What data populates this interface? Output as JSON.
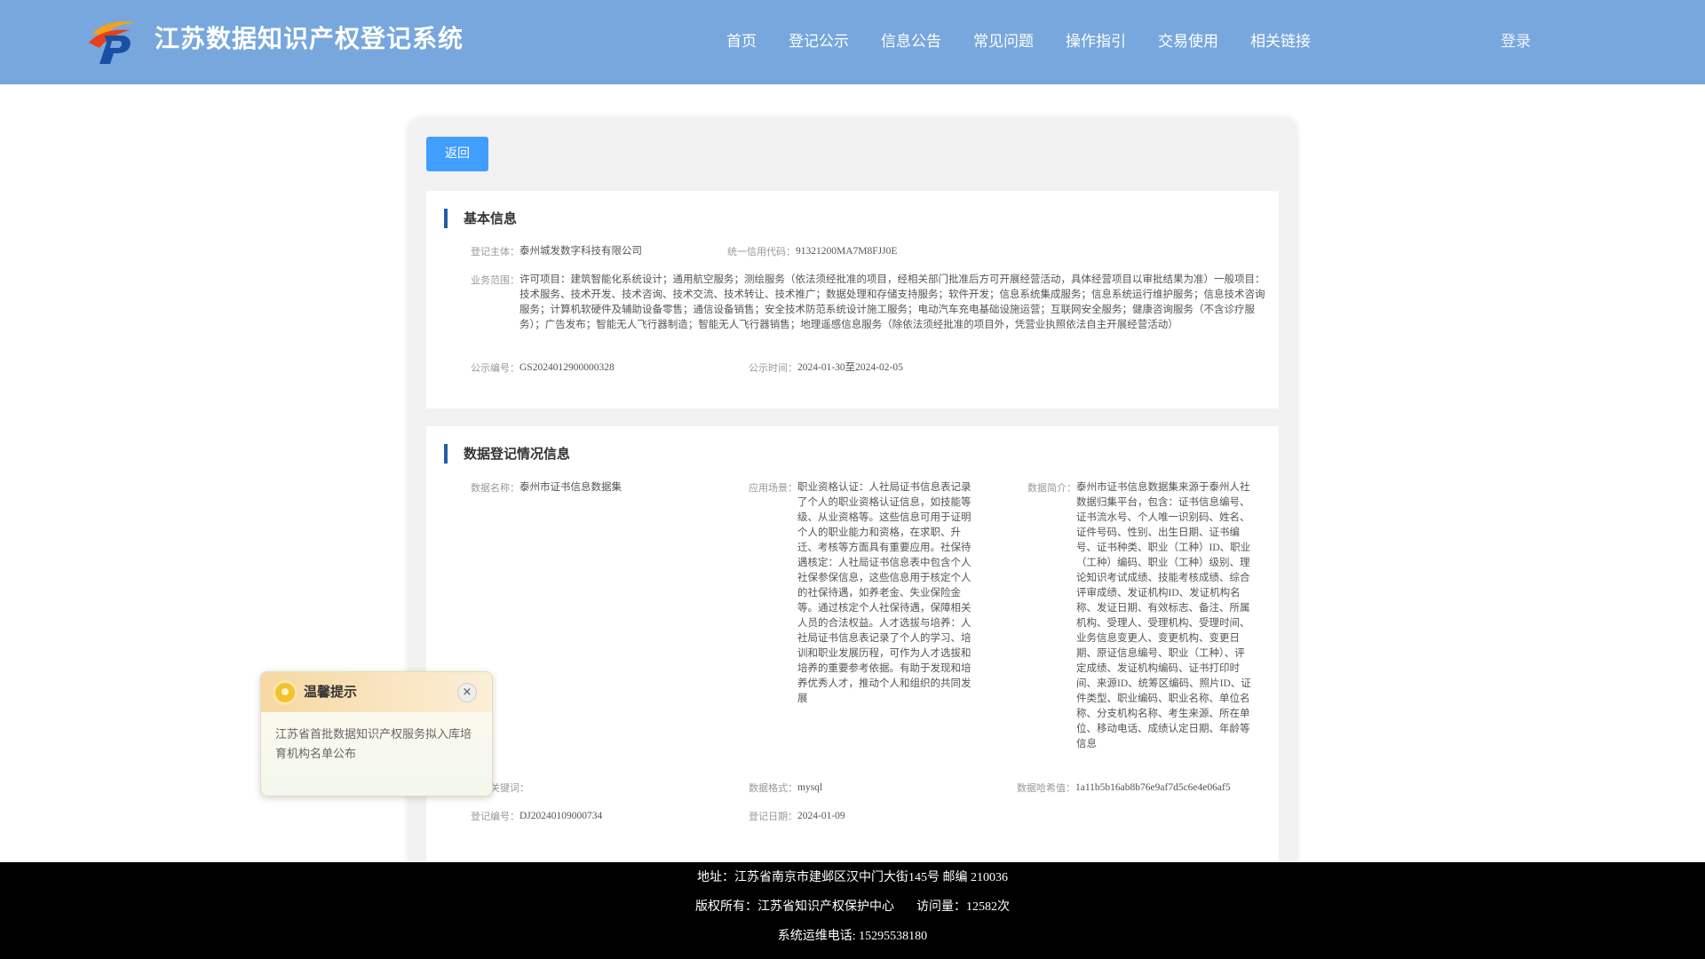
{
  "header": {
    "site_title": "江苏数据知识产权登记系统",
    "nav": [
      "首页",
      "登记公示",
      "信息公告",
      "常见问题",
      "操作指引",
      "交易使用",
      "相关链接"
    ],
    "login": "登录"
  },
  "main": {
    "back_button": "返回",
    "basic_info": {
      "title": "基本信息",
      "subject_label": "登记主体：",
      "subject_value": "泰州城发数字科技有限公司",
      "credit_code_label": "统一信用代码：",
      "credit_code_value": "91321200MA7M8FJJ0E",
      "scope_label": "业务范围：",
      "scope_value": "许可项目：建筑智能化系统设计；通用航空服务；测绘服务（依法须经批准的项目，经相关部门批准后方可开展经营活动，具体经营项目以审批结果为准）一般项目：技术服务、技术开发、技术咨询、技术交流、技术转让、技术推广；数据处理和存储支持服务；软件开发；信息系统集成服务；信息系统运行维护服务；信息技术咨询服务；计算机软硬件及辅助设备零售；通信设备销售；安全技术防范系统设计施工服务；电动汽车充电基础设施运营；互联网安全服务；健康咨询服务（不含诊疗服务）；广告发布；智能无人飞行器制造；智能无人飞行器销售；地理遥感信息服务（除依法须经批准的项目外，凭营业执照依法自主开展经营活动）",
      "pub_no_label": "公示编号：",
      "pub_no_value": "GS2024012900000328",
      "pub_time_label": "公示时间：",
      "pub_time_value": "2024-01-30至2024-02-05"
    },
    "registration": {
      "title": "数据登记情况信息",
      "data_name_label": "数据名称：",
      "data_name_value": "泰州市证书信息数据集",
      "scenario_label": "应用场景：",
      "scenario_value": "职业资格认证：人社局证书信息表记录了个人的职业资格认证信息，如技能等级、从业资格等。这些信息可用于证明个人的职业能力和资格，在求职、升迁、考核等方面具有重要应用。社保待遇核定：人社局证书信息表中包含个人社保参保信息，这些信息用于核定个人的社保待遇，如养老金、失业保险金等。通过核定个人社保待遇，保障相关人员的合法权益。人才选拔与培养：人社局证书信息表记录了个人的学习、培训和职业发展历程，可作为人才选拔和培养的重要参考依据。有助于发现和培养优秀人才，推动个人和组织的共同发展",
      "intro_label": "数据简介：",
      "intro_value": "泰州市证书信息数据集来源于泰州人社数据归集平台，包含：证书信息编号、证书流水号、个人唯一识别码、姓名、证件号码、性别、出生日期、证书编号、证书种类、职业（工种）ID、职业（工种）编码、职业（工种）级别、理论知识考试成绩、技能考核成绩、综合评审成绩、发证机构ID、发证机构名称、发证日期、有效标志、备注、所属机构、受理人、受理机构、受理时间、业务信息变更人、变更机构、变更日期、原证信息编号、职业（工种）、评定成绩、发证机构编码、证书打印时间、来源ID、统筹区编码、照片ID、证件类型、职业编码、职业名称、单位名称、分支机构名称、考生来源、所在单位、移动电话、成绩认定日期、年龄等信息",
      "keyword_label": "数据关键词：",
      "keyword_value": "",
      "format_label": "数据格式：",
      "format_value": "mysql",
      "hash_label": "数据哈希值：",
      "hash_value": "1a11b5b16ab8b76e9af7d5c6e4e06af5",
      "reg_no_label": "登记编号：",
      "reg_no_value": "DJ20240109000734",
      "reg_date_label": "登记日期：",
      "reg_date_value": "2024-01-09"
    }
  },
  "popup": {
    "title": "温馨提示",
    "close": "×",
    "body": "江苏省首批数据知识产权服务拟入库培育机构名单公布"
  },
  "footer": {
    "address": "地址：江苏省南京市建邺区汉中门大街145号 邮编 210036",
    "copyright": "版权所有：江苏省知识产权保护中心",
    "visits": "访问量：12582次",
    "phone": "系统运维电话: 15295538180"
  },
  "colors": {
    "header_bg": "#77a7dd",
    "accent": "#409eff",
    "title_bar": "#1f5ea8",
    "footer_bg": "#000000"
  }
}
